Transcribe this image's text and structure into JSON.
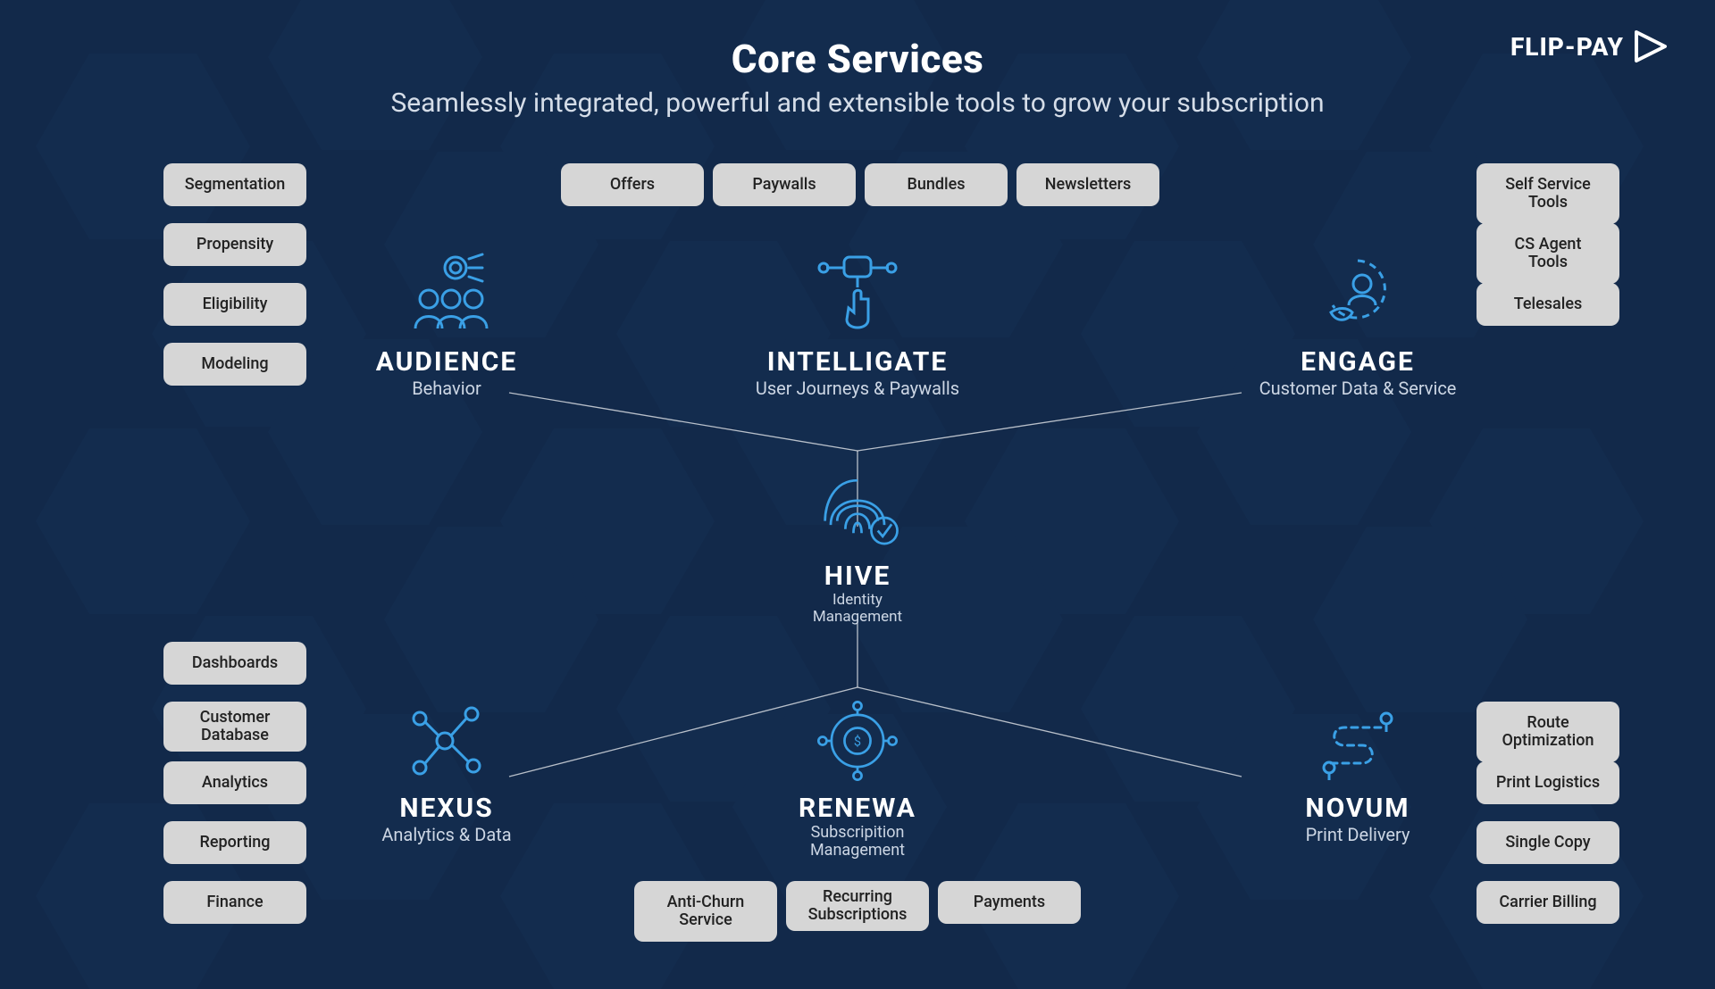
{
  "header": {
    "title": "Core Services",
    "subtitle": "Seamlessly integrated, powerful and extensible tools to grow your subscription"
  },
  "brand": {
    "name": "FLIP-PAY"
  },
  "services": {
    "audience": {
      "name": "AUDIENCE",
      "tag": "Behavior"
    },
    "intelligate": {
      "name": "INTELLIGATE",
      "tag": "User Journeys & Paywalls"
    },
    "engage": {
      "name": "ENGAGE",
      "tag": "Customer Data & Service"
    },
    "hive": {
      "name": "HIVE",
      "tag_line1": "Identity",
      "tag_line2": "Management"
    },
    "nexus": {
      "name": "NEXUS",
      "tag": "Analytics & Data"
    },
    "renewa": {
      "name": "RENEWA",
      "tag_line1": "Subscripition",
      "tag_line2": "Management"
    },
    "novum": {
      "name": "NOVUM",
      "tag": "Print Delivery"
    }
  },
  "chips": {
    "audience": [
      "Segmentation",
      "Propensity",
      "Eligibility",
      "Modeling"
    ],
    "intelligate": [
      "Offers",
      "Paywalls",
      "Bundles",
      "Newsletters"
    ],
    "engage": [
      "Self Service Tools",
      "CS Agent Tools",
      "Telesales"
    ],
    "nexus": [
      "Dashboards",
      "Customer Database",
      "Analytics",
      "Reporting",
      "Finance"
    ],
    "renewa": [
      "Anti-Churn Service",
      "Recurring Subscriptions",
      "Payments"
    ],
    "novum": [
      "Route Optimization",
      "Print Logistics",
      "Single Copy",
      "Carrier Billing"
    ]
  }
}
